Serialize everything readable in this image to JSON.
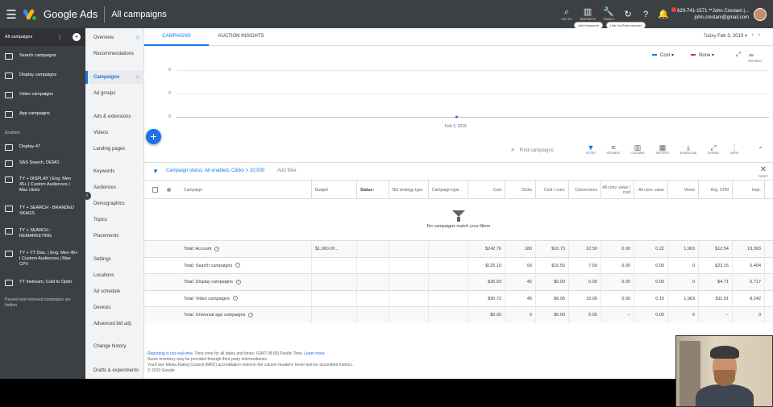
{
  "topbar": {
    "brand": "Google Ads",
    "page": "All campaigns",
    "buttons": [
      {
        "icon": "search-icon",
        "glyph": "⌕",
        "label": "GO TO"
      },
      {
        "icon": "reports-icon",
        "glyph": "▥",
        "label": "REPORTS"
      },
      {
        "icon": "tools-icon",
        "glyph": "🔧",
        "label": "TOOLS"
      }
    ],
    "account_line1": "620-741-1571 **John Crestani |...",
    "account_line2": "john.crestani@gmail.com",
    "chips": [
      "Add Keywords",
      "Link YouTube channel"
    ]
  },
  "leftnav": {
    "header": "All campaigns",
    "campaigns_top": [
      {
        "label": "Search campaigns",
        "icon": "search-campaign-icon"
      },
      {
        "label": "Display campaigns",
        "icon": "display-campaign-icon"
      },
      {
        "label": "Video campaigns",
        "icon": "video-campaign-icon"
      },
      {
        "label": "App campaigns",
        "icon": "app-campaign-icon"
      }
    ],
    "enabled_label": "Enabled",
    "campaigns_enabled": [
      {
        "label": "Display-47",
        "icon": "display-campaign-icon"
      },
      {
        "label": "SAS Search, DEMO",
        "icon": "search-campaign-icon"
      },
      {
        "label": "TY + DISPLAY | Eng. Men 45+ | Custom Audiences | Max clicks",
        "icon": "display-campaign-icon"
      },
      {
        "label": "TY + SEARCH - BRANDED SKAGS",
        "icon": "search-campaign-icon"
      },
      {
        "label": "TY + SEARCH - REMARKETING",
        "icon": "search-campaign-icon"
      },
      {
        "label": "TY + YT Disc. | Eng. Men 45+ | Custom Audiences | Max CPV",
        "icon": "video-campaign-icon"
      },
      {
        "label": "YT Instream, Cold to Optin",
        "icon": "video-campaign-icon"
      }
    ],
    "note": "Paused and removed campaigns are hidden"
  },
  "subnav": {
    "items": [
      "Overview",
      "Recommendations",
      "Campaigns",
      "Ad groups",
      "Ads & extensions",
      "Videos",
      "Landing pages",
      "Keywords",
      "Audiences",
      "Demographics",
      "Topics",
      "Placements",
      "Settings",
      "Locations",
      "Ad schedule",
      "Devices",
      "Advanced bid adj.",
      "Change history",
      "Drafts & experiments"
    ]
  },
  "tabs": [
    "CAMPAIGNS",
    "AUCTION INSIGHTS"
  ],
  "date": {
    "prefix": "Today",
    "value": "Feb 3, 2019"
  },
  "chart": {
    "metric1": "Cost",
    "metric1_color": "#1a73e8",
    "metric2": "None",
    "metric2_color": "#d93025",
    "tools_label": "REFRESH",
    "y_ticks": [
      "0",
      "0",
      "0"
    ],
    "x_tick": "Feb 3, 2019"
  },
  "chart_data": {
    "type": "line",
    "x": [
      "Feb 3, 2019"
    ],
    "series": [
      {
        "name": "Cost",
        "values": [
          0
        ]
      }
    ],
    "xlabel": "",
    "ylabel": "",
    "ylim": [
      0,
      0
    ]
  },
  "toolbar": {
    "search_placeholder": "Find campaigns",
    "icons": [
      {
        "name": "filter-icon",
        "glyph": "▼",
        "label": "FILTER"
      },
      {
        "name": "segment-icon",
        "glyph": "≡",
        "label": "SEGMENT"
      },
      {
        "name": "columns-icon",
        "glyph": "▥",
        "label": "COLUMNS"
      },
      {
        "name": "reports-icon",
        "glyph": "▦",
        "label": "REPORTS"
      },
      {
        "name": "download-icon",
        "glyph": "⤓",
        "label": "DOWNLOAD"
      },
      {
        "name": "expand-icon",
        "glyph": "⤢",
        "label": "EXPAND"
      },
      {
        "name": "more-icon",
        "glyph": "⋮",
        "label": "MORE"
      }
    ]
  },
  "filter": {
    "text": "Campaign status: All enabled, Clicks > 10,000",
    "add": "Add filter",
    "reset": "RESET"
  },
  "table": {
    "headers": [
      "Campaign",
      "Budget",
      "Status",
      "Bid strategy type",
      "Campaign type",
      "Cost",
      "Clicks",
      "Cost / conv.",
      "Conversions",
      "All conv. value / cost",
      "All conv. value",
      "Views",
      "Avg. CPM",
      "Impr."
    ],
    "empty_message": "No campaigns match your filters",
    "totals": [
      {
        "label": "Total: Account",
        "budget": "$1,060.00...",
        "cost": "$242.76",
        "clicks": "180",
        "cpc": "$10.73",
        "conv": "22.50",
        "vpc": "0.00",
        "allv": "0.22",
        "views": "1,963",
        "cpm": "$12.54",
        "impr": "19,363"
      },
      {
        "label": "Total: Search campaigns",
        "budget": "",
        "cost": "$125.10",
        "clicks": "93",
        "cpc": "$16.50",
        "conv": "7.50",
        "vpc": "0.00",
        "allv": "0.00",
        "views": "0",
        "cpm": "$23.15",
        "impr": "5,404"
      },
      {
        "label": "Total: Display campaigns",
        "budget": "",
        "cost": "$26.93",
        "clicks": "42",
        "cpc": "$0.00",
        "conv": "0.00",
        "vpc": "0.00",
        "allv": "0.00",
        "views": "0",
        "cpm": "$4.71",
        "impr": "5,717"
      },
      {
        "label": "Total: Video campaigns",
        "budget": "",
        "cost": "$90.72",
        "clicks": "45",
        "cpc": "$6.05",
        "conv": "15.00",
        "vpc": "0.00",
        "allv": "0.15",
        "views": "1,963",
        "cpm": "$11.01",
        "impr": "8,242"
      },
      {
        "label": "Total: Universal app campaigns",
        "budget": "",
        "cost": "$0.00",
        "clicks": "0",
        "cpc": "$0.00",
        "conv": "0.00",
        "vpc": "--",
        "allv": "0.00",
        "views": "0",
        "cpm": "--",
        "impr": "0"
      }
    ]
  },
  "footer": {
    "line1a": "Reporting is not real-time.",
    "line1b": " Time zone for all dates and times: (GMT-08:00) Pacific Time. ",
    "line1c": "Learn more",
    "line2": "Some inventory may be provided through third party intermediaries.",
    "line3": "You'll see Media Rating Council (MRC) accreditation noted in the column headers' hover text for accredited metrics.",
    "line4": "© 2019 Google"
  }
}
